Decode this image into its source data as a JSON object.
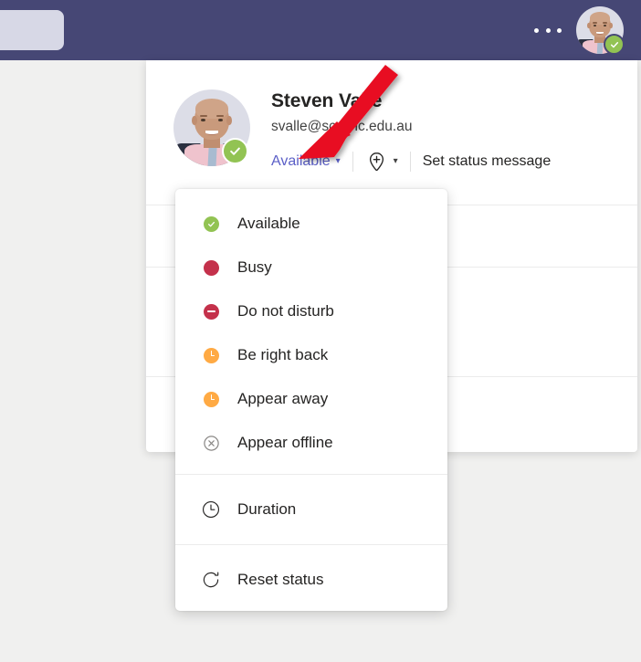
{
  "topbar": {
    "background_color": "#464775",
    "search_placeholder": "",
    "more_options_label": "More options",
    "avatar_alt": "Steven Valle",
    "presence": "Available"
  },
  "profile_card": {
    "name": "Steven Valle",
    "email": "svalle@scg.vic.edu.au",
    "status_label": "Available",
    "status_color": "#5b5fc7",
    "add_location_label": "",
    "set_status_message_label": "Set status message"
  },
  "status_menu": {
    "presence_options": [
      {
        "label": "Available",
        "icon": "available-icon",
        "color": "#92c353"
      },
      {
        "label": "Busy",
        "icon": "busy-icon",
        "color": "#c4314b"
      },
      {
        "label": "Do not disturb",
        "icon": "do-not-disturb-icon",
        "color": "#c4314b"
      },
      {
        "label": "Be right back",
        "icon": "be-right-back-icon",
        "color": "#ffaa44"
      },
      {
        "label": "Appear away",
        "icon": "appear-away-icon",
        "color": "#ffaa44"
      },
      {
        "label": "Appear offline",
        "icon": "appear-offline-icon",
        "color": "#8a8886"
      }
    ],
    "duration": {
      "label": "Duration",
      "icon": "clock-icon"
    },
    "reset": {
      "label": "Reset status",
      "icon": "refresh-icon"
    }
  },
  "annotation": {
    "arrow_color": "#e81123",
    "points_at": "Available"
  }
}
